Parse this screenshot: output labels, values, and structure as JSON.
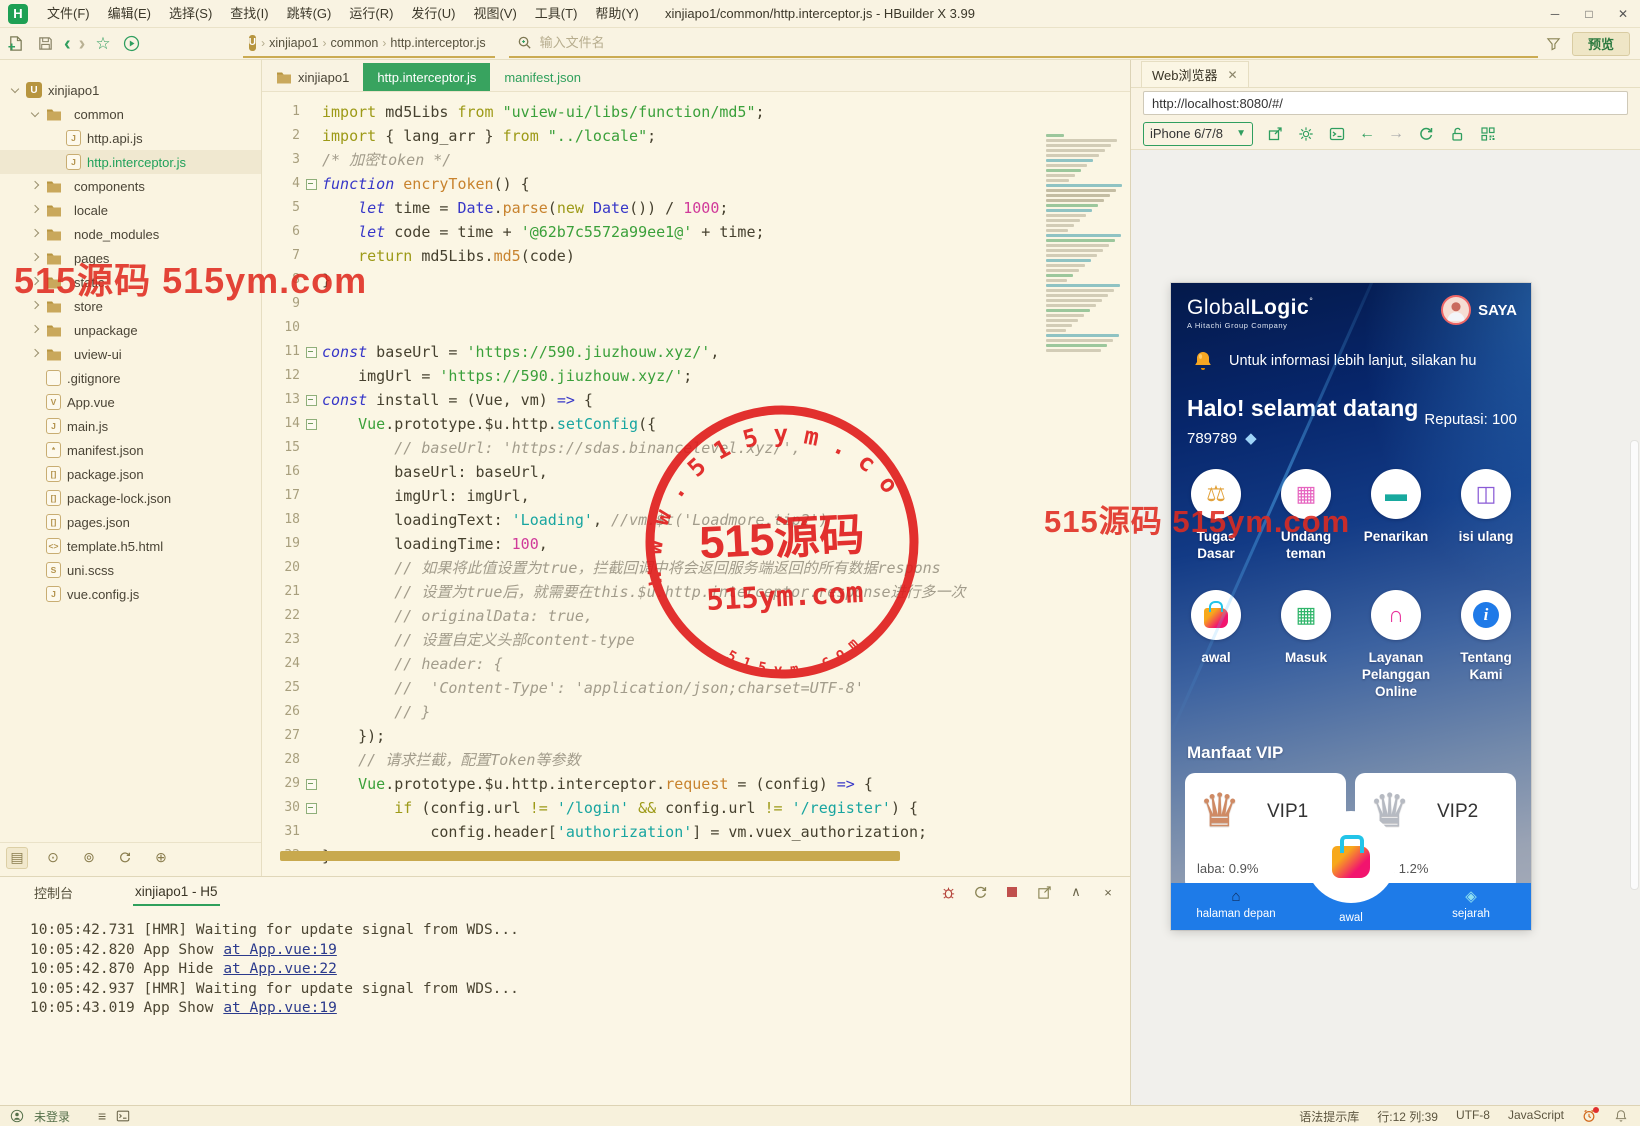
{
  "window": {
    "title": "xinjiapo1/common/http.interceptor.js - HBuilder X 3.99",
    "logo": "H",
    "controls": {
      "minimize": "─",
      "maximize": "□",
      "close": "✕"
    }
  },
  "menu": {
    "items": [
      "文件(F)",
      "编辑(E)",
      "选择(S)",
      "查找(I)",
      "跳转(G)",
      "运行(R)",
      "发行(U)",
      "视图(V)",
      "工具(T)",
      "帮助(Y)"
    ]
  },
  "toolbar": {
    "breadcrumb_logo": "U",
    "breadcrumb": [
      "xinjiapo1",
      "common",
      "http.interceptor.js"
    ],
    "search_placeholder": "输入文件名",
    "preview_label": "预览"
  },
  "sidebar": {
    "items": [
      {
        "label": "xinjiapo1",
        "depth": 0,
        "icon": "project",
        "chevron": "open"
      },
      {
        "label": "common",
        "depth": 1,
        "icon": "folder",
        "chevron": "open"
      },
      {
        "label": "http.api.js",
        "depth": 2,
        "icon": "js",
        "chevron": "none"
      },
      {
        "label": "http.interceptor.js",
        "depth": 2,
        "icon": "js",
        "chevron": "none",
        "selected": true
      },
      {
        "label": "components",
        "depth": 1,
        "icon": "folder",
        "chevron": "closed"
      },
      {
        "label": "locale",
        "depth": 1,
        "icon": "folder",
        "chevron": "closed"
      },
      {
        "label": "node_modules",
        "depth": 1,
        "icon": "folder",
        "chevron": "closed"
      },
      {
        "label": "pages",
        "depth": 1,
        "icon": "folder",
        "chevron": "closed"
      },
      {
        "label": "static",
        "depth": 1,
        "icon": "folder",
        "chevron": "closed"
      },
      {
        "label": "store",
        "depth": 1,
        "icon": "folder",
        "chevron": "closed"
      },
      {
        "label": "unpackage",
        "depth": 1,
        "icon": "folder",
        "chevron": "closed"
      },
      {
        "label": "uview-ui",
        "depth": 1,
        "icon": "folder",
        "chevron": "closed"
      },
      {
        "label": ".gitignore",
        "depth": 1,
        "icon": "file",
        "chevron": "none"
      },
      {
        "label": "App.vue",
        "depth": 1,
        "icon": "vue",
        "chevron": "none"
      },
      {
        "label": "main.js",
        "depth": 1,
        "icon": "js",
        "chevron": "none"
      },
      {
        "label": "manifest.json",
        "depth": 1,
        "icon": "manifest",
        "chevron": "none"
      },
      {
        "label": "package.json",
        "depth": 1,
        "icon": "json",
        "chevron": "none"
      },
      {
        "label": "package-lock.json",
        "depth": 1,
        "icon": "json",
        "chevron": "none"
      },
      {
        "label": "pages.json",
        "depth": 1,
        "icon": "json",
        "chevron": "none"
      },
      {
        "label": "template.h5.html",
        "depth": 1,
        "icon": "html",
        "chevron": "none"
      },
      {
        "label": "uni.scss",
        "depth": 1,
        "icon": "scss",
        "chevron": "none"
      },
      {
        "label": "vue.config.js",
        "depth": 1,
        "icon": "js",
        "chevron": "none"
      }
    ]
  },
  "editor": {
    "tabs": [
      {
        "label": "xinjiapo1",
        "icon": "folder"
      },
      {
        "label": "http.interceptor.js",
        "active": true
      },
      {
        "label": "manifest.json",
        "accent": true
      }
    ],
    "lines": [
      {
        "n": 1,
        "tokens": [
          [
            "k",
            "import"
          ],
          [
            "d",
            " md5Libs "
          ],
          [
            "k",
            "from"
          ],
          [
            "s",
            " \"uview-ui/libs/function/md5\""
          ],
          [
            "d",
            ";"
          ]
        ]
      },
      {
        "n": 2,
        "tokens": [
          [
            "k",
            "import"
          ],
          [
            "d",
            " { lang_arr } "
          ],
          [
            "k",
            "from"
          ],
          [
            "s",
            " \"../locale\""
          ],
          [
            "d",
            ";"
          ]
        ]
      },
      {
        "n": 3,
        "tokens": [
          [
            "c",
            "/* 加密token */"
          ]
        ]
      },
      {
        "n": 4,
        "fold": true,
        "tokens": [
          [
            "kb",
            "function"
          ],
          [
            "f",
            " encryToken"
          ],
          [
            "d",
            "() {"
          ]
        ]
      },
      {
        "n": 5,
        "tokens": [
          [
            "d",
            "    "
          ],
          [
            "kb",
            "let"
          ],
          [
            "d",
            " time = "
          ],
          [
            "b",
            "Date"
          ],
          [
            "d",
            "."
          ],
          [
            "f",
            "parse"
          ],
          [
            "d",
            "("
          ],
          [
            "k",
            "new"
          ],
          [
            "d",
            " "
          ],
          [
            "b",
            "Date"
          ],
          [
            "d",
            "()) / "
          ],
          [
            "n",
            "1000"
          ],
          [
            "d",
            ";"
          ]
        ]
      },
      {
        "n": 6,
        "tokens": [
          [
            "d",
            "    "
          ],
          [
            "kb",
            "let"
          ],
          [
            "d",
            " code = time + "
          ],
          [
            "s",
            "'@62b7c5572a99ee1@'"
          ],
          [
            "d",
            " + time;"
          ]
        ]
      },
      {
        "n": 7,
        "tokens": [
          [
            "d",
            "    "
          ],
          [
            "k",
            "return"
          ],
          [
            "d",
            " md5Libs."
          ],
          [
            "f",
            "md5"
          ],
          [
            "d",
            "(code)"
          ]
        ]
      },
      {
        "n": 8,
        "tokens": [
          [
            "d",
            "}"
          ]
        ]
      },
      {
        "n": 9,
        "tokens": []
      },
      {
        "n": 10,
        "tokens": []
      },
      {
        "n": 11,
        "fold": true,
        "tokens": [
          [
            "kb",
            "const"
          ],
          [
            "d",
            " baseUrl = "
          ],
          [
            "s",
            "'https://590.jiuzhouw.xyz/'"
          ],
          [
            "d",
            ","
          ]
        ]
      },
      {
        "n": 12,
        "tokens": [
          [
            "d",
            "    imgUrl = "
          ],
          [
            "s",
            "'https://590.jiuzhouw.xyz/'"
          ],
          [
            "d",
            ";"
          ]
        ]
      },
      {
        "n": 13,
        "fold": true,
        "tokens": [
          [
            "kb",
            "const"
          ],
          [
            "d",
            " install = (Vue, vm) "
          ],
          [
            "a",
            "=>"
          ],
          [
            "d",
            " {"
          ]
        ]
      },
      {
        "n": 14,
        "fold": true,
        "tokens": [
          [
            "d",
            "    "
          ],
          [
            "g",
            "Vue"
          ],
          [
            "d",
            ".prototype.$u.http."
          ],
          [
            "ft",
            "setConfig"
          ],
          [
            "d",
            "({"
          ]
        ]
      },
      {
        "n": 15,
        "tokens": [
          [
            "d",
            "        "
          ],
          [
            "c",
            "// baseUrl: 'https://sdas.binancelevel.xyz/',"
          ]
        ]
      },
      {
        "n": 16,
        "tokens": [
          [
            "d",
            "        baseUrl: baseUrl,"
          ]
        ]
      },
      {
        "n": 17,
        "tokens": [
          [
            "d",
            "        imgUrl: imgUrl,"
          ]
        ]
      },
      {
        "n": 18,
        "tokens": [
          [
            "d",
            "        loadingText: "
          ],
          [
            "st",
            "'Loading'"
          ],
          [
            "d",
            ", "
          ],
          [
            "c",
            "//vm.$t('Loadmore.tip2')"
          ]
        ]
      },
      {
        "n": 19,
        "tokens": [
          [
            "d",
            "        loadingTime: "
          ],
          [
            "n",
            "100"
          ],
          [
            "d",
            ","
          ]
        ]
      },
      {
        "n": 20,
        "tokens": [
          [
            "d",
            "        "
          ],
          [
            "c",
            "// 如果将此值设置为true，拦截回调中将会返回服务端返回的所有数据respons"
          ]
        ]
      },
      {
        "n": 21,
        "tokens": [
          [
            "d",
            "        "
          ],
          [
            "c",
            "// 设置为true后，就需要在this.$u.http.interceptor.response进行多一次"
          ]
        ]
      },
      {
        "n": 22,
        "tokens": [
          [
            "d",
            "        "
          ],
          [
            "c",
            "// originalData: true,"
          ]
        ]
      },
      {
        "n": 23,
        "tokens": [
          [
            "d",
            "        "
          ],
          [
            "c",
            "// 设置自定义头部content-type"
          ]
        ]
      },
      {
        "n": 24,
        "tokens": [
          [
            "d",
            "        "
          ],
          [
            "c",
            "// header: {"
          ]
        ]
      },
      {
        "n": 25,
        "tokens": [
          [
            "d",
            "        "
          ],
          [
            "c",
            "//  'Content-Type': 'application/json;charset=UTF-8'"
          ]
        ]
      },
      {
        "n": 26,
        "tokens": [
          [
            "d",
            "        "
          ],
          [
            "c",
            "// }"
          ]
        ]
      },
      {
        "n": 27,
        "tokens": [
          [
            "d",
            "    });"
          ]
        ]
      },
      {
        "n": 28,
        "tokens": [
          [
            "d",
            "    "
          ],
          [
            "c",
            "// 请求拦截，配置Token等参数"
          ]
        ]
      },
      {
        "n": 29,
        "fold": true,
        "tokens": [
          [
            "d",
            "    "
          ],
          [
            "g",
            "Vue"
          ],
          [
            "d",
            ".prototype.$u.http.interceptor."
          ],
          [
            "f",
            "request"
          ],
          [
            "d",
            " = (config) "
          ],
          [
            "a",
            "=>"
          ],
          [
            "d",
            " {"
          ]
        ]
      },
      {
        "n": 30,
        "fold": true,
        "tokens": [
          [
            "d",
            "        "
          ],
          [
            "k",
            "if"
          ],
          [
            "d",
            " (config.url "
          ],
          [
            "k",
            "!="
          ],
          [
            "d",
            " "
          ],
          [
            "st",
            "'/login'"
          ],
          [
            "d",
            " "
          ],
          [
            "k",
            "&&"
          ],
          [
            "d",
            " config.url "
          ],
          [
            "k",
            "!="
          ],
          [
            "d",
            " "
          ],
          [
            "st",
            "'/register'"
          ],
          [
            "d",
            ") {"
          ]
        ]
      },
      {
        "n": 31,
        "tokens": [
          [
            "d",
            "            config.header["
          ],
          [
            "st",
            "'authorization'"
          ],
          [
            "d",
            "] = vm.vuex_authorization;"
          ]
        ]
      },
      {
        "n": 32,
        "tokens": [
          [
            "d",
            "}"
          ]
        ]
      }
    ]
  },
  "console": {
    "label": "控制台",
    "tab": "xinjiapo1 - H5",
    "logs": [
      {
        "text": "10:05:42.731 [HMR] Waiting for update signal from WDS..."
      },
      {
        "text": "10:05:42.820 App Show",
        "link": "at App.vue:19"
      },
      {
        "text": "10:05:42.870 App Hide",
        "link": "at App.vue:22"
      },
      {
        "text": "10:05:42.937 [HMR] Waiting for update signal from WDS..."
      },
      {
        "text": "10:05:43.019 App Show",
        "link": "at App.vue:19"
      }
    ]
  },
  "statusbar": {
    "login": "未登录",
    "right": [
      "语法提示库",
      "行:12 列:39",
      "UTF-8",
      "JavaScript"
    ]
  },
  "browser": {
    "tab": "Web浏览器",
    "close": "✕",
    "url": "http://localhost:8080/#/",
    "device": "iPhone 6/7/8"
  },
  "phone": {
    "logo_light": "Global",
    "logo_bold": "Logic",
    "logo_sub": "A Hitachi Group Company",
    "profile": "SAYA",
    "notice": "Untuk informasi lebih lanjut, silakan hu",
    "welcome": "Halo! selamat datang",
    "reputation": "Reputasi: 100",
    "balance": "789789",
    "grid": [
      {
        "label": "Tugas Dasar",
        "icon": "scale"
      },
      {
        "label": "Undang teman",
        "icon": "calendar"
      },
      {
        "label": "Penarikan",
        "icon": "bank-card"
      },
      {
        "label": "isi ulang",
        "icon": "atm"
      },
      {
        "label": "awal",
        "icon": "shopping-bag"
      },
      {
        "label": "Masuk",
        "icon": "calendar-check"
      },
      {
        "label": "Layanan Pelanggan Online",
        "icon": "headset"
      },
      {
        "label": "Tentang Kami",
        "icon": "info"
      }
    ],
    "vip_heading": "Manfaat VIP",
    "vip_cards": [
      {
        "name": "VIP1",
        "profit": "laba: 0.9%",
        "tier": "bronze"
      },
      {
        "name": "VIP2",
        "profit": "laba: 1.2%",
        "tier": "silver"
      }
    ],
    "tabbar": [
      {
        "label": "halaman depan",
        "icon": "home"
      },
      {
        "label": "awal",
        "icon": "bag"
      },
      {
        "label": "sejarah",
        "icon": "history"
      }
    ]
  },
  "watermark": {
    "text": "515源码 515ym.com",
    "stamp_arc_top": "w w w . 5 1 5 y m . c o m",
    "stamp_center": "515源码",
    "stamp_mid": "515ym.com",
    "stamp_arc_bottom": "5 1 5 y m . c o m"
  }
}
